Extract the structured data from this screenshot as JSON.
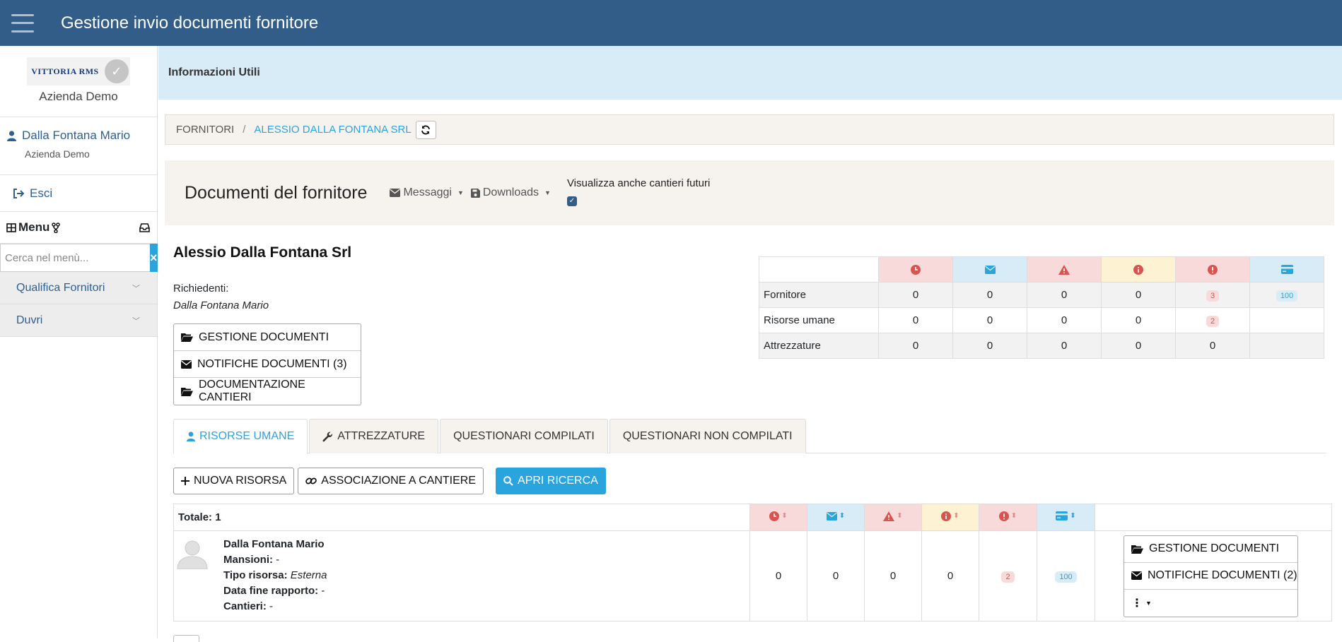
{
  "app": {
    "title": "Gestione invio documenti fornitore"
  },
  "sidebar": {
    "logo_text": "VITTORIA RMS",
    "company": "Azienda Demo",
    "user": {
      "name": "Dalla Fontana Mario",
      "company": "Azienda Demo"
    },
    "logout_label": "Esci",
    "menu_label": "Menu",
    "search_placeholder": "Cerca nel menù...",
    "search_clear": "×",
    "items": [
      {
        "label": "Qualifica Fornitori"
      },
      {
        "label": "Duvri"
      }
    ]
  },
  "info_bar": {
    "label": "Informazioni Utili"
  },
  "breadcrumb": {
    "root": "FORNITORI",
    "separator": "/",
    "current": "ALESSIO DALLA FONTANA SRL"
  },
  "doc_header": {
    "title": "Documenti del fornitore",
    "messages_label": "Messaggi",
    "downloads_label": "Downloads",
    "future_label": "Visualizza anche cantieri futuri",
    "future_checked": true
  },
  "supplier": {
    "name": "Alessio Dalla Fontana Srl",
    "requesters_label": "Richiedenti:",
    "requester": "Dalla Fontana Mario",
    "buttons": [
      "GESTIONE DOCUMENTI",
      "NOTIFICHE DOCUMENTI (3)",
      "DOCUMENTAZIONE CANTIERI"
    ]
  },
  "summary": {
    "rows": [
      {
        "label": "Fornitore",
        "values": [
          "0",
          "0",
          "0",
          "0",
          "3",
          "100"
        ]
      },
      {
        "label": "Risorse umane",
        "values": [
          "0",
          "0",
          "0",
          "0",
          "2",
          ""
        ]
      },
      {
        "label": "Attrezzature",
        "values": [
          "0",
          "0",
          "0",
          "0",
          "0",
          ""
        ]
      }
    ]
  },
  "tabs": [
    {
      "label": "RISORSE UMANE",
      "active": true
    },
    {
      "label": "ATTREZZATURE",
      "active": false
    },
    {
      "label": "QUESTIONARI COMPILATI",
      "active": false
    },
    {
      "label": "QUESTIONARI NON COMPILATI",
      "active": false
    }
  ],
  "actions": {
    "new": "NUOVA RISORSA",
    "link": "ASSOCIAZIONE A CANTIERE",
    "search": "APRI RICERCA"
  },
  "list": {
    "total_label": "Totale: 1",
    "rows": [
      {
        "name": "Dalla Fontana Mario",
        "mansioni_label": "Mansioni:",
        "mansioni": "-",
        "tipo_label": "Tipo risorsa:",
        "tipo": "Esterna",
        "fine_label": "Data fine rapporto:",
        "fine": "-",
        "cantieri_label": "Cantieri:",
        "cantieri": "-",
        "values": [
          "0",
          "0",
          "0",
          "0",
          "2",
          "100"
        ],
        "buttons": [
          "GESTIONE DOCUMENTI",
          "NOTIFICHE DOCUMENTI (2)"
        ]
      }
    ]
  }
}
